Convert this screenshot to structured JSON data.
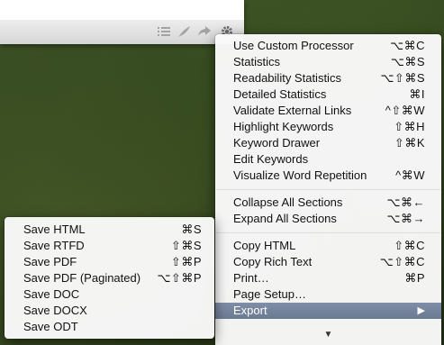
{
  "main_menu": {
    "items": [
      {
        "label": "Use Custom Processor",
        "shortcut": "⌥⌘C"
      },
      {
        "label": "Statistics",
        "shortcut": "⌥⌘S"
      },
      {
        "label": "Readability Statistics",
        "shortcut": "⌥⇧⌘S"
      },
      {
        "label": "Detailed Statistics",
        "shortcut": "⌘I"
      },
      {
        "label": "Validate External Links",
        "shortcut": "^⇧⌘W"
      },
      {
        "label": "Highlight Keywords",
        "shortcut": "⇧⌘H"
      },
      {
        "label": "Keyword Drawer",
        "shortcut": "⇧⌘K"
      },
      {
        "label": "Edit Keywords",
        "shortcut": ""
      },
      {
        "label": "Visualize Word Repetition",
        "shortcut": "^⌘W"
      },
      {
        "label": "Collapse All Sections",
        "shortcut": "⌥⌘←"
      },
      {
        "label": "Expand All Sections",
        "shortcut": "⌥⌘→"
      },
      {
        "label": "Copy HTML",
        "shortcut": "⇧⌘C"
      },
      {
        "label": "Copy Rich Text",
        "shortcut": "⌥⇧⌘C"
      },
      {
        "label": "Print…",
        "shortcut": "⌘P"
      },
      {
        "label": "Page Setup…",
        "shortcut": ""
      },
      {
        "label": "Export",
        "shortcut": "",
        "submenu_arrow": "▶"
      }
    ],
    "scroll_down_arrow": "▼"
  },
  "export_submenu": {
    "items": [
      {
        "label": "Save HTML",
        "shortcut": "⌘S"
      },
      {
        "label": "Save RTFD",
        "shortcut": "⇧⌘S"
      },
      {
        "label": "Save PDF",
        "shortcut": "⇧⌘P"
      },
      {
        "label": "Save PDF (Paginated)",
        "shortcut": "⌥⇧⌘P"
      },
      {
        "label": "Save DOC",
        "shortcut": ""
      },
      {
        "label": "Save DOCX",
        "shortcut": ""
      },
      {
        "label": "Save ODT",
        "shortcut": ""
      }
    ]
  },
  "toolbar": {
    "icons": [
      "list-icon",
      "quill-icon",
      "share-arrow-icon",
      "gear-icon"
    ]
  },
  "colors": {
    "selection": "#6f7e98",
    "desktop": "#34491f"
  }
}
